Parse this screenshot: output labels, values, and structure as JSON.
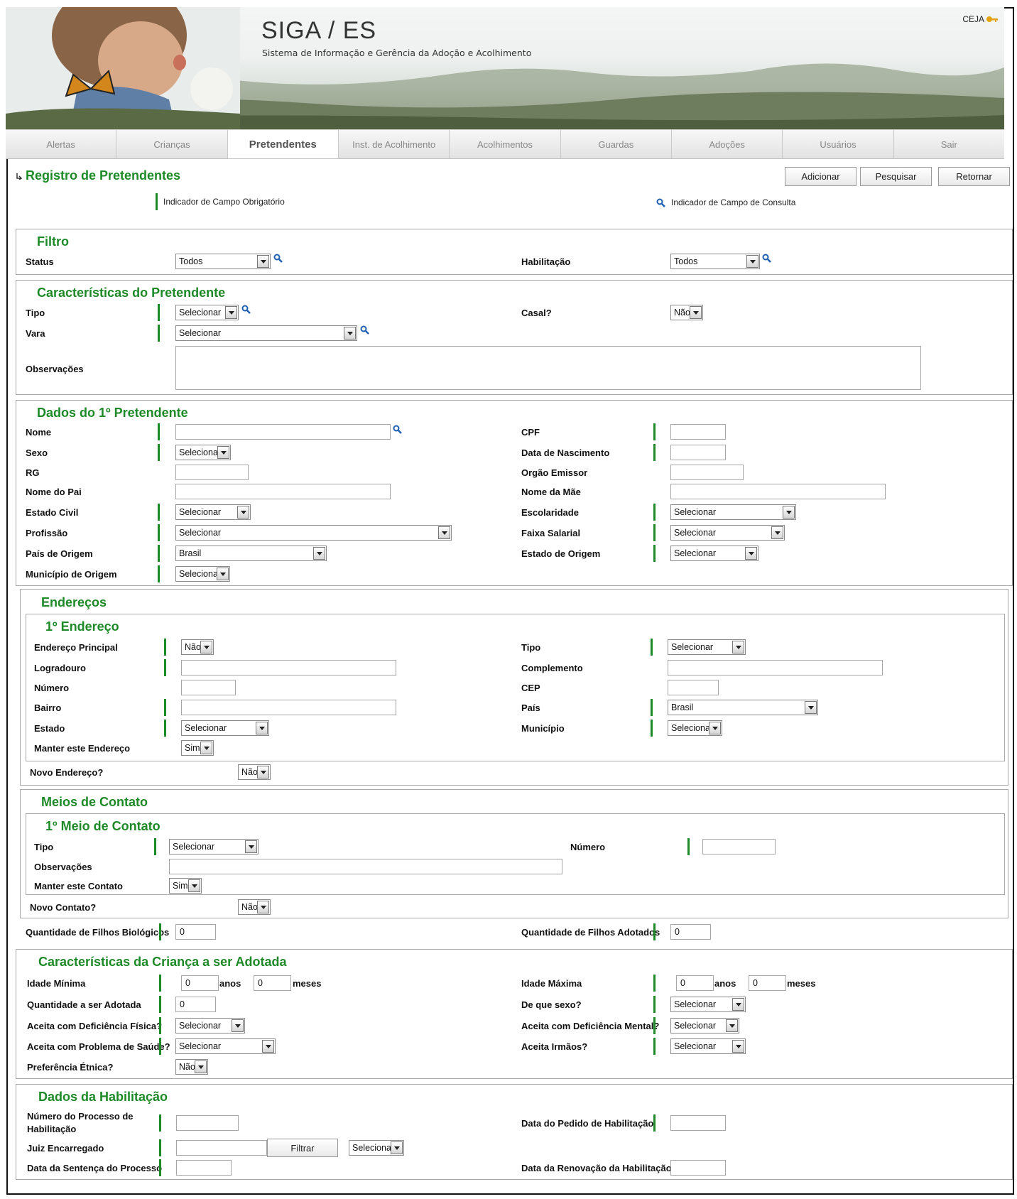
{
  "header": {
    "title": "SIGA / ES",
    "subtitle": "Sistema de Informação e Gerência da Adoção e Acolhimento",
    "ceja": "CEJA"
  },
  "nav": [
    "Alertas",
    "Crianças",
    "Pretendentes",
    "Inst. de Acolhimento",
    "Acolhimentos",
    "Guardas",
    "Adoções",
    "Usuários",
    "Sair"
  ],
  "page": {
    "title": "Registro de Pretendentes",
    "buttons": {
      "add": "Adicionar",
      "search": "Pesquisar",
      "back": "Retornar"
    },
    "legend_required": "Indicador de Campo Obrigatório",
    "legend_search": "Indicador de Campo de Consulta"
  },
  "filtro": {
    "title": "Filtro",
    "status_label": "Status",
    "status_value": "Todos",
    "hab_label": "Habilitação",
    "hab_value": "Todos"
  },
  "carac": {
    "title": "Características do Pretendente",
    "tipo_label": "Tipo",
    "tipo_value": "Selecionar",
    "casal_label": "Casal?",
    "casal_value": "Não",
    "vara_label": "Vara",
    "vara_value": "Selecionar",
    "obs_label": "Observações"
  },
  "dados1": {
    "title": "Dados do 1º Pretendente",
    "nome": "Nome",
    "cpf": "CPF",
    "sexo": "Sexo",
    "sexo_value": "Selecionar",
    "nasc": "Data de Nascimento",
    "rg": "RG",
    "orgao": "Orgão Emissor",
    "pai": "Nome do Pai",
    "mae": "Nome da Mãe",
    "civil": "Estado Civil",
    "civil_value": "Selecionar",
    "escol": "Escolaridade",
    "escol_value": "Selecionar",
    "prof": "Profissão",
    "prof_value": "Selecionar",
    "faixa": "Faixa Salarial",
    "faixa_value": "Selecionar",
    "pais": "País de Origem",
    "pais_value": "Brasil",
    "estado": "Estado de Origem",
    "estado_value": "Selecionar",
    "mun": "Município de Origem",
    "mun_value": "Selecionar"
  },
  "enderecos": {
    "title": "Endereços",
    "sub": "1º Endereço",
    "principal": "Endereço Principal",
    "principal_value": "Não",
    "tipo": "Tipo",
    "tipo_value": "Selecionar",
    "logr": "Logradouro",
    "compl": "Complemento",
    "numero": "Número",
    "cep": "CEP",
    "bairro": "Bairro",
    "pais": "País",
    "pais_value": "Brasil",
    "estado": "Estado",
    "estado_value": "Selecionar",
    "mun": "Município",
    "mun_value": "Selecionar",
    "manter": "Manter este Endereço",
    "manter_value": "Sim",
    "novo": "Novo Endereço?",
    "novo_value": "Não"
  },
  "contato": {
    "title": "Meios de Contato",
    "sub": "1º Meio de Contato",
    "tipo": "Tipo",
    "tipo_value": "Selecionar",
    "numero": "Número",
    "obs": "Observações",
    "manter": "Manter este Contato",
    "manter_value": "Sim",
    "novo": "Novo Contato?",
    "novo_value": "Não"
  },
  "filhos": {
    "bio": "Quantidade de Filhos Biológicos",
    "bio_value": "0",
    "adot": "Quantidade de Filhos Adotados",
    "adot_value": "0"
  },
  "crianca": {
    "title": "Características da Criança a ser Adotada",
    "idmin": "Idade Mínima",
    "idmin_anos": "0",
    "idmin_meses": "0",
    "anos": "anos",
    "meses": "meses",
    "idmax": "Idade Máxima",
    "idmax_anos": "0",
    "idmax_meses": "0",
    "qtd": "Quantidade a ser Adotada",
    "qtd_value": "0",
    "sexo": "De que sexo?",
    "sexo_value": "Selecionar",
    "fis": "Aceita com Deficiência Física?",
    "fis_value": "Selecionar",
    "ment": "Aceita com Deficiência Mental?",
    "ment_value": "Selecionar",
    "saude": "Aceita com Problema de Saúde?",
    "saude_value": "Selecionar",
    "irmaos": "Aceita Irmãos?",
    "irmaos_value": "Selecionar",
    "etnica": "Preferência Étnica?",
    "etnica_value": "Não"
  },
  "hab": {
    "title": "Dados da Habilitação",
    "proc1": "Número do Processo de",
    "proc2": "Habilitação",
    "pedido": "Data do Pedido de Habilitação",
    "juiz": "Juiz Encarregado",
    "filtrar": "Filtrar",
    "juiz_value": "Selecionar",
    "sentenca": "Data da Sentença do Processo",
    "renov": "Data da Renovação da Habilitação"
  },
  "colors": {
    "accent": "#1d8a27",
    "required_bar": "#1d8a27",
    "search_icon": "#1f5fb0"
  },
  "icons": {
    "search": "magnifier-icon",
    "key": "key-icon",
    "arrow": "bullet-arrow-icon",
    "dropdown": "chevron-down-icon"
  }
}
